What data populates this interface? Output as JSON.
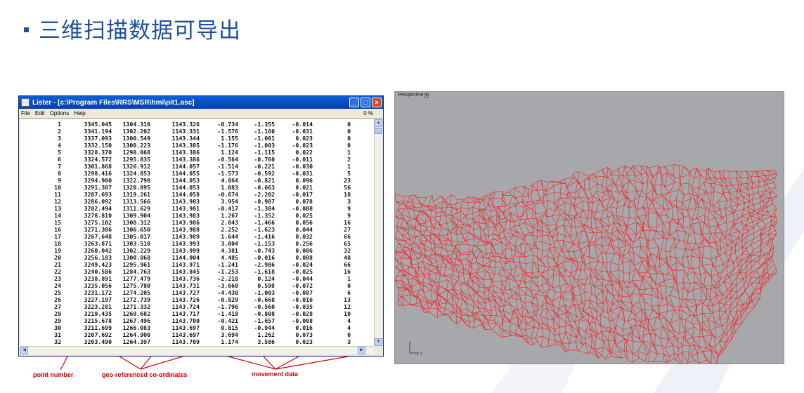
{
  "slide": {
    "title": "三维扫描数据可导出"
  },
  "lister": {
    "title": "Lister - [c:\\Program Files\\RRS\\MSR\\hmi\\pit1.asc]",
    "menu": [
      "File",
      "Edit",
      "Options",
      "Help"
    ],
    "percent": "0 %",
    "rows": [
      [
        "1",
        "3345.045",
        "1304.310",
        "1143.326",
        "-0.734",
        "-1.355",
        "-0.014",
        "0"
      ],
      [
        "2",
        "3341.194",
        "1302.202",
        "1143.331",
        "-1.576",
        "-1.160",
        "-0.031",
        "0"
      ],
      [
        "3",
        "3337.093",
        "1300.549",
        "1143.344",
        "1.155",
        "-1.001",
        "0.023",
        "0"
      ],
      [
        "4",
        "3332.150",
        "1300.223",
        "1143.385",
        "-1.176",
        "-1.003",
        "-0.023",
        "0"
      ],
      [
        "5",
        "3328.370",
        "1298.068",
        "1143.386",
        "1.124",
        "-1.115",
        "0.022",
        "1"
      ],
      [
        "6",
        "3324.572",
        "1295.835",
        "1143.386",
        "-0.564",
        "-0.760",
        "-0.011",
        "2"
      ],
      [
        "7",
        "3301.868",
        "1326.912",
        "1144.057",
        "-1.514",
        "-0.221",
        "-0.030",
        "1"
      ],
      [
        "8",
        "3298.416",
        "1324.853",
        "1144.055",
        "-1.573",
        "-0.592",
        "-0.031",
        "5"
      ],
      [
        "9",
        "3294.900",
        "1322.798",
        "1144.053",
        "4.864",
        "-0.821",
        "0.096",
        "23"
      ],
      [
        "10",
        "3291.387",
        "1320.895",
        "1144.053",
        "1.083",
        "-0.663",
        "0.021",
        "56"
      ],
      [
        "11",
        "3287.693",
        "1319.261",
        "1144.058",
        "-0.874",
        "-2.202",
        "-0.017",
        "18"
      ],
      [
        "12",
        "3286.092",
        "1313.566",
        "1143.983",
        "3.954",
        "-0.987",
        "0.078",
        "3"
      ],
      [
        "13",
        "3282.494",
        "1311.629",
        "1143.981",
        "-0.417",
        "-1.384",
        "-0.008",
        "9"
      ],
      [
        "14",
        "3278.810",
        "1309.904",
        "1143.983",
        "1.267",
        "-1.352",
        "0.025",
        "9"
      ],
      [
        "15",
        "3275.102",
        "1308.312",
        "1143.986",
        "2.843",
        "-1.466",
        "0.056",
        "16"
      ],
      [
        "16",
        "3271.386",
        "1306.650",
        "1143.988",
        "2.252",
        "-1.623",
        "0.044",
        "27"
      ],
      [
        "17",
        "3267.648",
        "1305.017",
        "1143.989",
        "1.644",
        "-1.416",
        "0.032",
        "66"
      ],
      [
        "18",
        "3263.871",
        "1303.510",
        "1143.993",
        "3.004",
        "-1.153",
        "0.256",
        "65"
      ],
      [
        "19",
        "3260.042",
        "1302.229",
        "1143.999",
        "4.381",
        "-0.743",
        "0.086",
        "32"
      ],
      [
        "20",
        "3256.183",
        "1300.868",
        "1144.004",
        "4.485",
        "-0.016",
        "0.088",
        "48"
      ],
      [
        "21",
        "3249.423",
        "1295.961",
        "1143.971",
        "-1.241",
        "-2.986",
        "-0.024",
        "66"
      ],
      [
        "22",
        "3240.586",
        "1284.763",
        "1143.845",
        "-1.253",
        "-1.618",
        "-0.025",
        "16"
      ],
      [
        "23",
        "3238.891",
        "1277.479",
        "1143.736",
        "-2.218",
        "0.124",
        "-0.044",
        "1"
      ],
      [
        "24",
        "3235.056",
        "1275.780",
        "1143.731",
        "-3.660",
        "0.598",
        "-0.072",
        "0"
      ],
      [
        "25",
        "3231.172",
        "1274.205",
        "1143.727",
        "-4.430",
        "-1.003",
        "-0.087",
        "6"
      ],
      [
        "26",
        "3227.197",
        "1272.739",
        "1143.726",
        "-0.829",
        "-0.668",
        "-0.016",
        "13"
      ],
      [
        "27",
        "3223.281",
        "1271.332",
        "1143.724",
        "-1.796",
        "-0.560",
        "-0.035",
        "12"
      ],
      [
        "28",
        "3219.435",
        "1269.682",
        "1143.717",
        "-1.418",
        "-0.808",
        "-0.028",
        "10"
      ],
      [
        "29",
        "3215.678",
        "1267.496",
        "1143.700",
        "-0.421",
        "-1.657",
        "-0.008",
        "4"
      ],
      [
        "30",
        "3211.699",
        "1266.083",
        "1143.697",
        "0.815",
        "-0.944",
        "0.016",
        "4"
      ],
      [
        "31",
        "3207.692",
        "1264.900",
        "1143.697",
        "3.694",
        "1.262",
        "0.073",
        "0"
      ],
      [
        "32",
        "3203.490",
        "1264.397",
        "1143.709",
        "1.174",
        "3.586",
        "0.023",
        "3"
      ]
    ]
  },
  "annotations": {
    "point_number": "point number",
    "geo": "geo-referenced co-ordinates",
    "movement": "movement data"
  },
  "viewport": {
    "label": "Perspective",
    "axis": "y x",
    "mesh_color": "#ff1a1a"
  },
  "colors": {
    "title": "#1f4e9e",
    "annotation": "#cc0000"
  }
}
